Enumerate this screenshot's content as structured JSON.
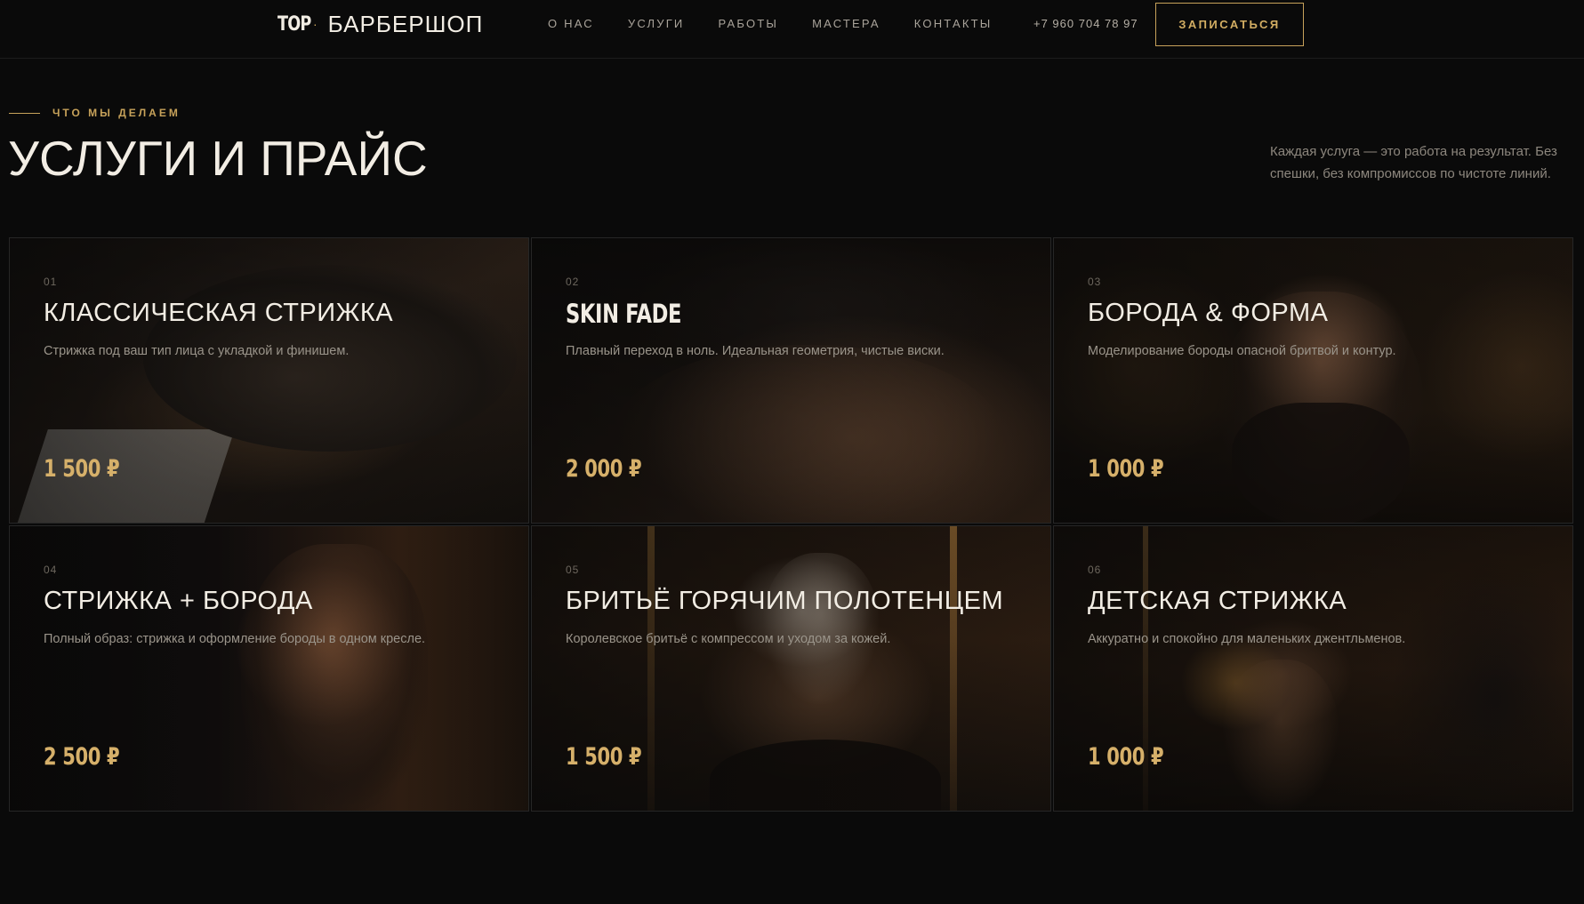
{
  "header": {
    "logo_mark": "TOP",
    "logo_separator": "·",
    "logo_name": "БАРБЕРШОП",
    "nav": [
      "О НАС",
      "УСЛУГИ",
      "РАБОТЫ",
      "МАСТЕРА",
      "КОНТАКТЫ"
    ],
    "phone": "+7 960 704 78 97",
    "cta_label": "ЗАПИСАТЬСЯ"
  },
  "section": {
    "eyebrow": "ЧТО МЫ ДЕЛАЕМ",
    "title": "УСЛУГИ И ПРАЙС",
    "description": "Каждая услуга — это работа на результат. Без спешки, без компромиссов по чистоте линий."
  },
  "services": [
    {
      "num": "01",
      "title": "КЛАССИЧЕСКАЯ СТРИЖКА",
      "desc": "Стрижка под ваш тип лица с укладкой и финишем.",
      "price": "1 500 ₽"
    },
    {
      "num": "02",
      "title": "SKIN FADE",
      "desc": "Плавный переход в ноль. Идеальная геометрия, чистые виски.",
      "price": "2 000 ₽"
    },
    {
      "num": "03",
      "title": "БОРОДА & ФОРМА",
      "desc": "Моделирование бороды опасной бритвой и контур.",
      "price": "1 000 ₽"
    },
    {
      "num": "04",
      "title": "СТРИЖКА + БОРОДА",
      "desc": "Полный образ: стрижка и оформление бороды в одном кресле.",
      "price": "2 500 ₽"
    },
    {
      "num": "05",
      "title": "БРИТЬЁ ГОРЯЧИМ ПОЛОТЕНЦЕМ",
      "desc": "Королевское бритьё с компрессом и уходом за кожей.",
      "price": "1 500 ₽"
    },
    {
      "num": "06",
      "title": "ДЕТСКАЯ СТРИЖКА",
      "desc": "Аккуратно и спокойно для маленьких джентльменов.",
      "price": "1 000 ₽"
    }
  ],
  "colors": {
    "background": "#0a0a0a",
    "accent_gold": "#c7a25a",
    "price_gold": "#d6b06a",
    "text_light": "#f2ede4",
    "text_muted": "#9a948a"
  }
}
